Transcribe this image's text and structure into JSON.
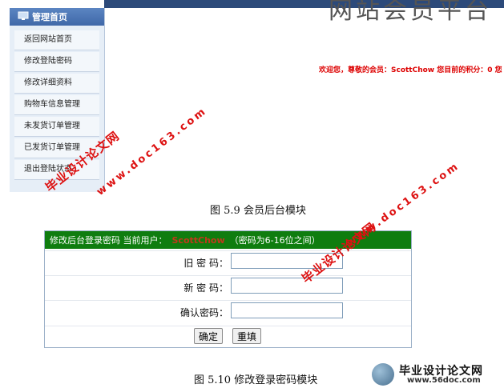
{
  "site_title": "网站会员平台",
  "sidebar": {
    "header": "管理首页",
    "items": [
      {
        "label": "返回网站首页"
      },
      {
        "label": "修改登陆密码"
      },
      {
        "label": "修改详细资料"
      },
      {
        "label": "购物车信息管理"
      },
      {
        "label": "未发货订单管理"
      },
      {
        "label": "已发货订单管理"
      },
      {
        "label": "退出登陆状态"
      }
    ]
  },
  "welcome_text": "欢迎您，尊敬的会员：ScottChow  您目前的积分：0  您",
  "caption1": "图 5.9  会员后台模块",
  "form": {
    "header_prefix": "修改后台登录密码  当前用户：",
    "current_user": "ScottChow",
    "header_hint": "（密码为6-16位之间）",
    "old_label": "旧 密 码：",
    "new_label": "新 密 码：",
    "confirm_label": "确认密码：",
    "old_value": "",
    "new_value": "",
    "confirm_value": "",
    "submit": "确定",
    "reset": "重填"
  },
  "caption2": "图 5.10  修改登录密码模块",
  "watermark": {
    "cn": "毕业设计论文网",
    "url": "www.doc163.com"
  },
  "logo": {
    "title": "毕业设计论文网",
    "url": "www.56doc.com"
  },
  "colors": {
    "form_header": "#0f7d0f",
    "welcome": "#dd0000",
    "watermark": "#dd1111"
  }
}
